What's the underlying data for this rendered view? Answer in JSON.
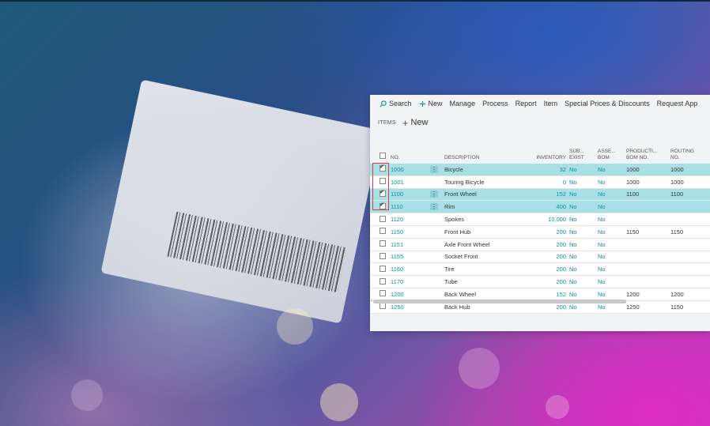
{
  "actionbar": {
    "items": [
      "Search",
      "New",
      "Manage",
      "Process",
      "Report",
      "Item",
      "Special Prices & Discounts",
      "Request App"
    ]
  },
  "subheader": {
    "items_label": "ITEMS",
    "new_label": "New"
  },
  "table": {
    "headers": {
      "no": "NO.",
      "description": "DESCRIPTION",
      "inventory": "INVENTORY",
      "sub_exist_1": "SUB...",
      "sub_exist_2": "EXIST",
      "asse_1": "ASSE...",
      "asse_2": "BOM",
      "prod_1": "PRODUCTI...",
      "prod_2": "BOM NO.",
      "routing_1": "ROUTING",
      "routing_2": "NO."
    },
    "rows": [
      {
        "no": "1000",
        "description": "Bicycle",
        "inventory": "32",
        "sub": "No",
        "asm": "No",
        "prod": "1000",
        "routing": "1000",
        "selected": true,
        "checked": true
      },
      {
        "no": "1001",
        "description": "Touring Bicycle",
        "inventory": "0",
        "sub": "No",
        "asm": "No",
        "prod": "1000",
        "routing": "1000",
        "selected": false,
        "checked": false
      },
      {
        "no": "1100",
        "description": "Front Wheel",
        "inventory": "152",
        "sub": "No",
        "asm": "No",
        "prod": "1100",
        "routing": "1100",
        "selected": true,
        "checked": true
      },
      {
        "no": "1110",
        "description": "Rim",
        "inventory": "400",
        "sub": "No",
        "asm": "No",
        "prod": "",
        "routing": "",
        "selected": true,
        "checked": true
      },
      {
        "no": "1120",
        "description": "Spokes",
        "inventory": "10,000",
        "sub": "No",
        "asm": "No",
        "prod": "",
        "routing": "",
        "selected": false,
        "checked": false
      },
      {
        "no": "1150",
        "description": "Front Hub",
        "inventory": "200",
        "sub": "No",
        "asm": "No",
        "prod": "1150",
        "routing": "1150",
        "selected": false,
        "checked": false
      },
      {
        "no": "1151",
        "description": "Axle Front Wheel",
        "inventory": "200",
        "sub": "No",
        "asm": "No",
        "prod": "",
        "routing": "",
        "selected": false,
        "checked": false
      },
      {
        "no": "1155",
        "description": "Socket Front",
        "inventory": "200",
        "sub": "No",
        "asm": "No",
        "prod": "",
        "routing": "",
        "selected": false,
        "checked": false
      },
      {
        "no": "1160",
        "description": "Tire",
        "inventory": "200",
        "sub": "No",
        "asm": "No",
        "prod": "",
        "routing": "",
        "selected": false,
        "checked": false
      },
      {
        "no": "1170",
        "description": "Tube",
        "inventory": "200",
        "sub": "No",
        "asm": "No",
        "prod": "",
        "routing": "",
        "selected": false,
        "checked": false
      },
      {
        "no": "1200",
        "description": "Back Wheel",
        "inventory": "152",
        "sub": "No",
        "asm": "No",
        "prod": "1200",
        "routing": "1200",
        "selected": false,
        "checked": false
      },
      {
        "no": "1250",
        "description": "Back Hub",
        "inventory": "200",
        "sub": "No",
        "asm": "No",
        "prod": "1250",
        "routing": "1150",
        "selected": false,
        "checked": false
      }
    ]
  },
  "colors": {
    "accent": "#0a8fa0",
    "selected_row": "#a8e0e6",
    "highlight_box": "#d94040"
  },
  "icons": [
    "search-icon",
    "plus-icon",
    "checkbox-icon",
    "row-menu-icon"
  ]
}
